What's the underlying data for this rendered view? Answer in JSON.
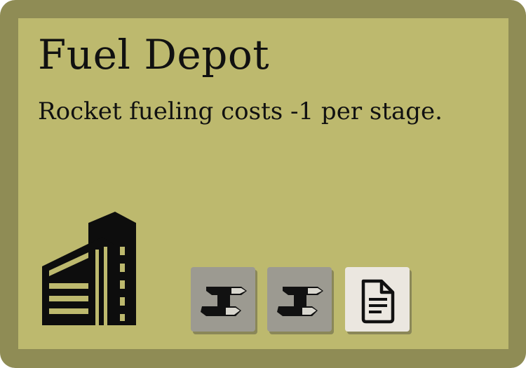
{
  "card": {
    "name": "Fuel Depot",
    "effect": "Rocket fueling costs -1 per stage.",
    "type_icon": "building-icon",
    "cost": [
      {
        "resource": "steel",
        "icon": "steel-beam-icon"
      },
      {
        "resource": "steel",
        "icon": "steel-beam-icon"
      },
      {
        "resource": "document",
        "icon": "document-icon"
      }
    ]
  },
  "colors": {
    "border": "#8f8c55",
    "face": "#bdb96e",
    "steel_tile": "#9c9a91",
    "document_tile": "#ebe7e0",
    "ink": "#111111"
  }
}
